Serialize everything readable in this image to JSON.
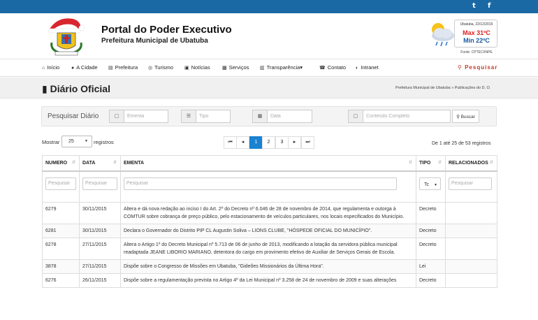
{
  "social": {
    "twitter": "t",
    "facebook": "f"
  },
  "header": {
    "title": "Portal do Poder Executivo",
    "subtitle": "Prefeitura Municipal de Ubatuba"
  },
  "weather": {
    "date": "Ubatuba, 22/12/2015",
    "max": "Max 31ºC",
    "min": "Min 22ºC",
    "source": "Fonte: CPTEC/INPE"
  },
  "nav": {
    "items": [
      {
        "label": "Início",
        "icon": "home-icon",
        "glyph": "⌂"
      },
      {
        "label": "A Cidade",
        "icon": "map-marker-icon",
        "glyph": "●"
      },
      {
        "label": "Prefeitura",
        "icon": "building-icon",
        "glyph": "▤"
      },
      {
        "label": "Turismo",
        "icon": "globe-icon",
        "glyph": "◎"
      },
      {
        "label": "Notícias",
        "icon": "newspaper-icon",
        "glyph": "▣"
      },
      {
        "label": "Serviços",
        "icon": "briefcase-icon",
        "glyph": "▩"
      },
      {
        "label": "Transparência",
        "icon": "bar-chart-icon",
        "glyph": "▥",
        "caret": "▾"
      },
      {
        "label": "Contato",
        "icon": "phone-icon",
        "glyph": "☎"
      },
      {
        "label": "Intranet",
        "icon": "dashboard-icon",
        "glyph": "◐"
      }
    ],
    "search": "Pesquisar"
  },
  "page": {
    "title": "Diário Oficial",
    "breadcrumb": "Prefeitura Municipal de Ubatuba » Publicações do D. O."
  },
  "filter": {
    "label": "Pesquisar Diário",
    "ementa_placeholder": "Ementa",
    "tipo_placeholder": "Tipo",
    "data_placeholder": "Data",
    "conteudo_placeholder": "Conteúdo Completo",
    "button": "Buscar"
  },
  "length": {
    "prefix": "Mostrar",
    "value": "25",
    "suffix": "registros"
  },
  "pagination": {
    "first": "⏮",
    "prev": "◂",
    "pages": [
      "1",
      "2",
      "3"
    ],
    "current": "1",
    "next": "▸",
    "last": "⏭"
  },
  "info": "De 1 até 25 de 53 registros",
  "table": {
    "columns": [
      "NUMERO",
      "DATA",
      "EMENTA",
      "TIPO",
      "RELACIONADOS"
    ],
    "filter_placeholder": "Pesquisar",
    "tipo_filter_value": "Tc",
    "rows": [
      {
        "numero": "6279",
        "data": "30/11/2015",
        "ementa": "Altera e dá nova redação ao inciso I do Art. 2º do Decreto nº 6.046 de 28 de novembro de 2014, que regulamenta e outorga à COMTUR sobre cobrança de preço público, pelo estacionamento de veículos particulares, nos locais especificados do Município.",
        "tipo": "Decreto",
        "relacionados": ""
      },
      {
        "numero": "6281",
        "data": "30/11/2015",
        "ementa": "Declara o Governador do Distrito PIP CL Augustin Soliva – LIONS CLUBE, \"HÓSPEDE OFICIAL DO MUNICÍPIO\".",
        "tipo": "Decreto",
        "relacionados": ""
      },
      {
        "numero": "6278",
        "data": "27/11/2015",
        "ementa": "Altera o Artigo 1º do Decreto Municipal nº 5.713 de 06 de junho de 2013, modificando a lotação da servidora pública municipal readaptada JEANE LIBORIO MARIANO, detentora do cargo em provimento efetivo de Auxiliar de Serviços Gerais de Escola.",
        "tipo": "Decreto",
        "relacionados": ""
      },
      {
        "numero": "3878",
        "data": "27/11/2015",
        "ementa": "Dispõe sobre o Congresso de Missões em Ubatuba, \"Gideões Missionários da Última Hora\".",
        "tipo": "Lei",
        "relacionados": ""
      },
      {
        "numero": "6276",
        "data": "26/11/2015",
        "ementa": "Dispõe sobre a regulamentação prevista no Artigo 4º da Lei Municipal nº 3.258 de 24 de novembro de 2009 e suas alterações",
        "tipo": "Decreto",
        "relacionados": ""
      }
    ]
  }
}
